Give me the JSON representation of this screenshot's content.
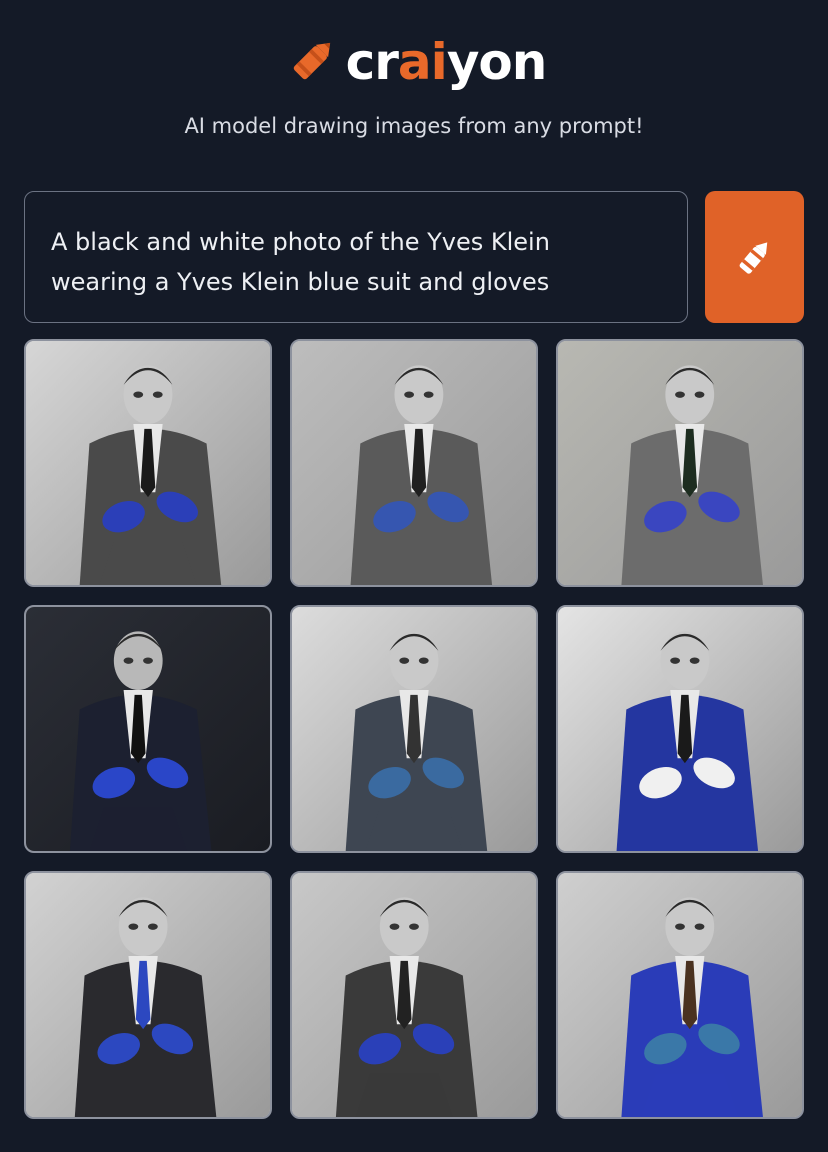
{
  "header": {
    "logo_text_before": "cr",
    "logo_text_accent": "ai",
    "logo_text_after": "yon",
    "tagline": "AI model drawing images from any prompt!"
  },
  "prompt": {
    "line1": "A black and white photo of the Yves Klein",
    "line2": "wearing a Yves Klein blue suit and gloves"
  },
  "draw_button": {
    "icon": "crayon-icon"
  },
  "colors": {
    "background": "#141a27",
    "accent": "#e06228",
    "klein_blue": "#2a3fb8"
  },
  "results": [
    {
      "id": "image-1",
      "bg": "#d6d6d6",
      "suit": "#4a4a4a",
      "glove": "#2b3fb8",
      "tie": "#1a1a1a"
    },
    {
      "id": "image-2",
      "bg": "#bdbdbd",
      "suit": "#5a5a5a",
      "glove": "#3656b0",
      "tie": "#202020"
    },
    {
      "id": "image-3",
      "bg": "#b8b8b2",
      "suit": "#6c6c6c",
      "glove": "#3a46c0",
      "tie": "#1d2d20"
    },
    {
      "id": "image-4",
      "bg": "#2b2e36",
      "suit": "#1c2030",
      "glove": "#2a46c8",
      "tie": "#111111"
    },
    {
      "id": "image-5",
      "bg": "#dcdcdc",
      "suit": "#3e4652",
      "glove": "#3a6aa0",
      "tie": "#333333"
    },
    {
      "id": "image-6",
      "bg": "#e4e4e4",
      "suit": "#2436a0",
      "glove": "#f0f0f0",
      "tie": "#1a1a1a"
    },
    {
      "id": "image-7",
      "bg": "#d2d2d2",
      "suit": "#2a2a2e",
      "glove": "#2c48c0",
      "tie": "#2c48c0"
    },
    {
      "id": "image-8",
      "bg": "#c8c8c8",
      "suit": "#3a3a3a",
      "glove": "#2a40b8",
      "tie": "#222222"
    },
    {
      "id": "image-9",
      "bg": "#cfcfcf",
      "suit": "#2a3cb8",
      "glove": "#3a78a8",
      "tie": "#4a3220"
    }
  ]
}
